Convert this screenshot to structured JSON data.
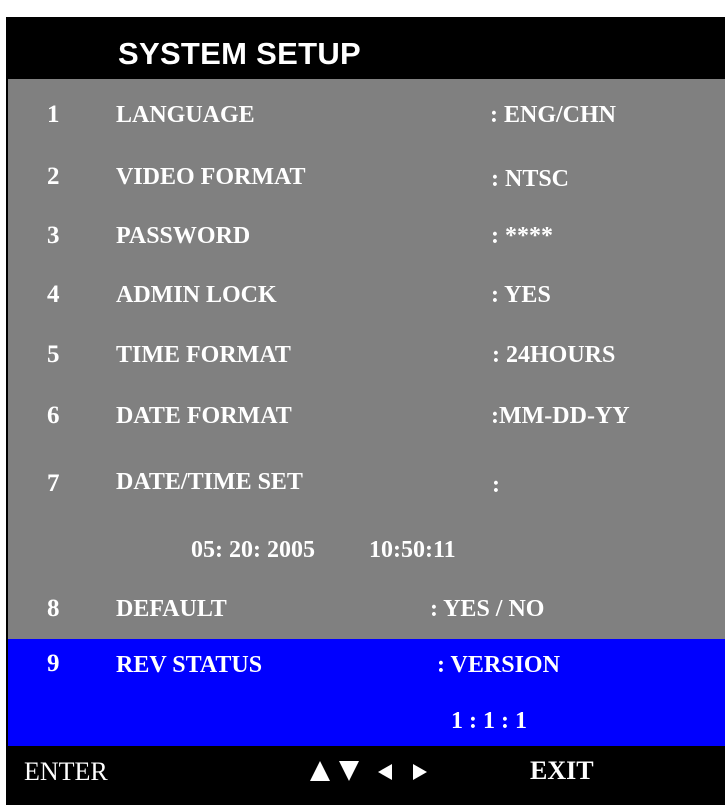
{
  "title": "SYSTEM SETUP",
  "items": [
    {
      "num": "1",
      "label": "LANGUAGE",
      "value": ": ENG/CHN"
    },
    {
      "num": "2",
      "label": "VIDEO FORMAT",
      "value": ": NTSC"
    },
    {
      "num": "3",
      "label": "PASSWORD",
      "value": ": ****"
    },
    {
      "num": "4",
      "label": "ADMIN LOCK",
      "value": ": YES"
    },
    {
      "num": "5",
      "label": "TIME FORMAT",
      "value": ": 24HOURS"
    },
    {
      "num": "6",
      "label": "DATE FORMAT",
      "value": ":MM-DD-YY"
    },
    {
      "num": "7",
      "label": "DATE/TIME SET",
      "value": ":"
    },
    {
      "num": "8",
      "label": "DEFAULT",
      "value": ": YES / NO"
    },
    {
      "num": "9",
      "label": "REV STATUS",
      "value": ": VERSION"
    }
  ],
  "datetime": {
    "date": "05: 20: 2005",
    "time": "10:50:11"
  },
  "version": "1 : 1 : 1",
  "footer": {
    "enter": "ENTER",
    "exit": "EXIT"
  },
  "icons": [
    "arrow-up-icon",
    "arrow-down-icon",
    "arrow-left-icon",
    "arrow-right-icon"
  ],
  "colors": {
    "screen": "#000000",
    "menu": "#808080",
    "selected": "#0000ff",
    "text": "#ffffff"
  }
}
